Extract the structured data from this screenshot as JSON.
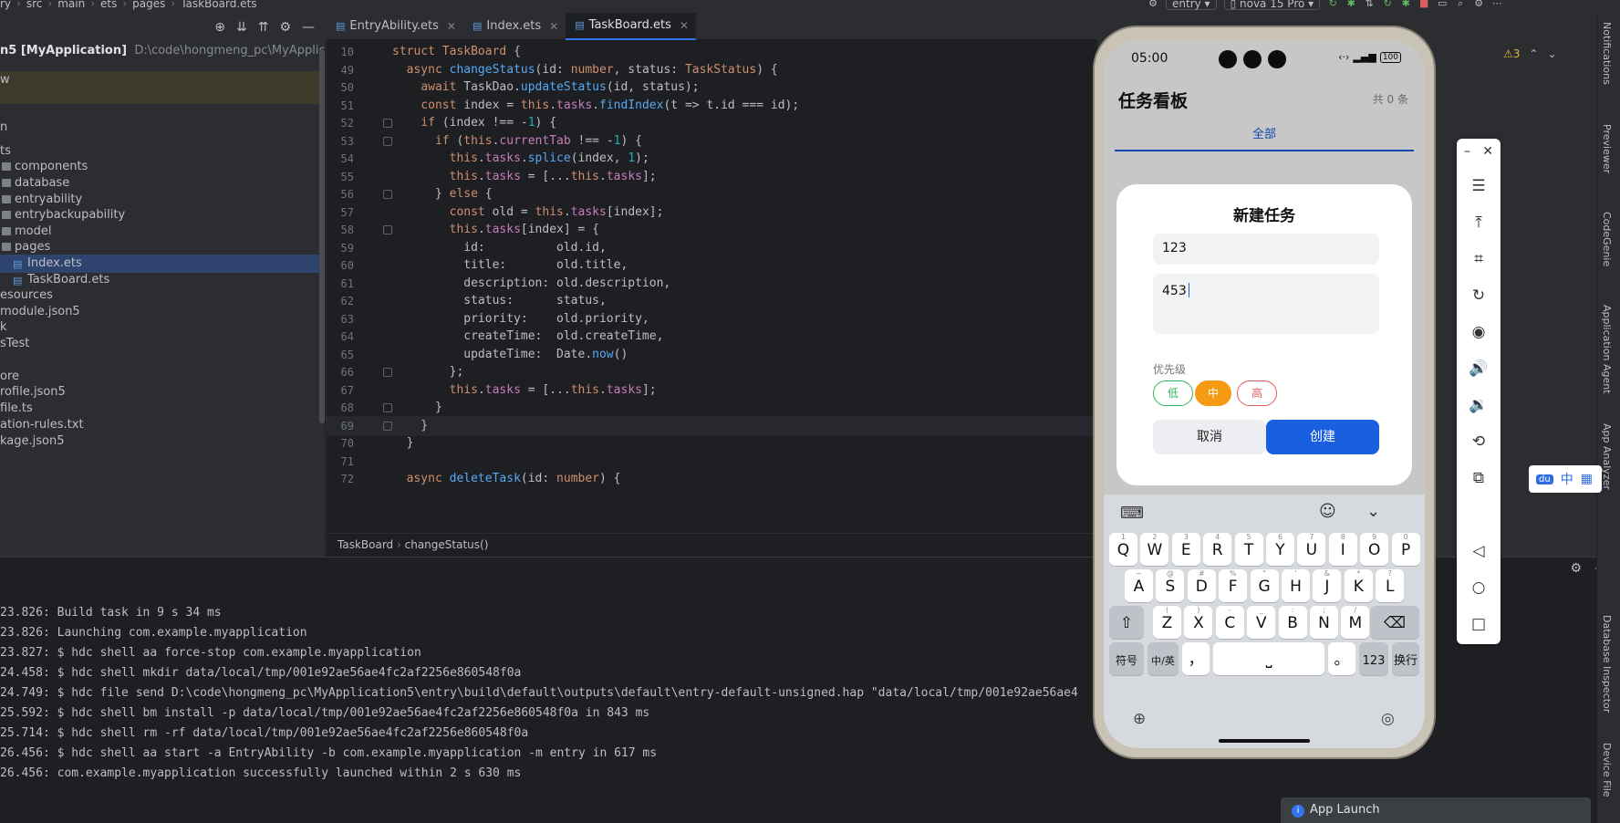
{
  "topbar": {
    "crumbs": [
      "ry",
      "src",
      "main",
      "ets",
      "pages",
      "TaskBoard.ets"
    ],
    "run_config": "entry",
    "device": "nova 15 Pro"
  },
  "project": {
    "root_name": "n5 [MyApplication]",
    "root_path": "D:\\code\\hongmeng_pc\\MyApplication5",
    "rows": [
      {
        "label": "w",
        "kind": "text",
        "indent": 0,
        "hl": true
      },
      {
        "label": "n",
        "kind": "text",
        "indent": 0
      },
      {
        "label": "ts",
        "kind": "text",
        "indent": 0
      },
      {
        "label": "components",
        "kind": "folder",
        "indent": 1
      },
      {
        "label": "database",
        "kind": "folder",
        "indent": 1
      },
      {
        "label": "entryability",
        "kind": "folder",
        "indent": 1
      },
      {
        "label": "entrybackupability",
        "kind": "folder",
        "indent": 1
      },
      {
        "label": "model",
        "kind": "folder",
        "indent": 1
      },
      {
        "label": "pages",
        "kind": "folder",
        "indent": 1
      },
      {
        "label": "Index.ets",
        "kind": "file",
        "indent": 2,
        "sel": true
      },
      {
        "label": "TaskBoard.ets",
        "kind": "file",
        "indent": 2
      },
      {
        "label": "esources",
        "kind": "text",
        "indent": 0
      },
      {
        "label": "module.json5",
        "kind": "text",
        "indent": 0
      },
      {
        "label": "k",
        "kind": "text",
        "indent": 0
      },
      {
        "label": "sTest",
        "kind": "text",
        "indent": 0
      },
      {
        "label": "",
        "kind": "text",
        "indent": 0
      },
      {
        "label": "ore",
        "kind": "text",
        "indent": 0
      },
      {
        "label": "rofile.json5",
        "kind": "text",
        "indent": 0
      },
      {
        "label": "file.ts",
        "kind": "text",
        "indent": 0
      },
      {
        "label": "ation-rules.txt",
        "kind": "text",
        "indent": 0
      },
      {
        "label": "kage.json5",
        "kind": "text",
        "indent": 0
      }
    ]
  },
  "tabs": [
    {
      "label": "EntryAbility.ets",
      "active": false
    },
    {
      "label": "Index.ets",
      "active": false
    },
    {
      "label": "TaskBoard.ets",
      "active": true
    }
  ],
  "warnings": {
    "count": "3"
  },
  "code_lines": [
    {
      "n": "10",
      "html": "<span class=\"kw\">struct</span> <span class=\"ty\">TaskBoard</span> {"
    },
    {
      "n": "49",
      "html": "  <span class=\"kw\">async</span> <span class=\"fn\">changeStatus</span>(id: <span class=\"kw\">number</span>, status: <span class=\"ty\">TaskStatus</span>) {"
    },
    {
      "n": "50",
      "html": "    <span class=\"kw\">await</span> TaskDao.<span class=\"fn\">updateStatus</span>(id, status);"
    },
    {
      "n": "51",
      "html": "    <span class=\"kw\">const</span> index = <span class=\"kw\">this</span>.<span class=\"pr\">tasks</span>.<span class=\"fn\">findIndex</span>(t => t.id === id);"
    },
    {
      "n": "52",
      "html": "    <span class=\"kw\">if</span> (index !== -<span class=\"nm\">1</span>) {"
    },
    {
      "n": "53",
      "html": "      <span class=\"kw\">if</span> (<span class=\"kw\">this</span>.<span class=\"pr\">currentTab</span> !== -<span class=\"nm\">1</span>) {"
    },
    {
      "n": "54",
      "html": "        <span class=\"kw\">this</span>.<span class=\"pr\">tasks</span>.<span class=\"fn\">splice</span>(index, <span class=\"nm\">1</span>);"
    },
    {
      "n": "55",
      "html": "        <span class=\"kw\">this</span>.<span class=\"pr\">tasks</span> = [...<span class=\"kw\">this</span>.<span class=\"pr\">tasks</span>];"
    },
    {
      "n": "56",
      "html": "      } <span class=\"kw\">else</span> {"
    },
    {
      "n": "57",
      "html": "        <span class=\"kw\">const</span> old = <span class=\"kw\">this</span>.<span class=\"pr\">tasks</span>[index];"
    },
    {
      "n": "58",
      "html": "        <span class=\"kw\">this</span>.<span class=\"pr\">tasks</span>[index] = {"
    },
    {
      "n": "59",
      "html": "          id:          old.id,"
    },
    {
      "n": "60",
      "html": "          title:       old.title,"
    },
    {
      "n": "61",
      "html": "          description: old.description,"
    },
    {
      "n": "62",
      "html": "          status:      status,"
    },
    {
      "n": "63",
      "html": "          priority:    old.priority,"
    },
    {
      "n": "64",
      "html": "          createTime:  old.createTime,"
    },
    {
      "n": "65",
      "html": "          updateTime:  Date.<span class=\"fn\">now</span>()"
    },
    {
      "n": "66",
      "html": "        };"
    },
    {
      "n": "67",
      "html": "        <span class=\"kw\">this</span>.<span class=\"pr\">tasks</span> = [...<span class=\"kw\">this</span>.<span class=\"pr\">tasks</span>];"
    },
    {
      "n": "68",
      "html": "      }"
    },
    {
      "n": "69",
      "html": "    }"
    },
    {
      "n": "70",
      "html": "  }"
    },
    {
      "n": "71",
      "html": ""
    },
    {
      "n": "72",
      "html": "  <span class=\"kw\">async</span> <span class=\"fn\">deleteTask</span>(id: <span class=\"kw\">number</span>) {"
    }
  ],
  "breadcrumb": {
    "a": "TaskBoard",
    "b": "changeStatus()"
  },
  "log_lines": [
    "23.826: Build task in 9 s 34 ms",
    "23.826: Launching com.example.myapplication",
    "23.827: $ hdc shell aa force-stop com.example.myapplication",
    "24.458: $ hdc shell mkdir data/local/tmp/001e92ae56ae4fc2af2256e860548f0a",
    "24.749: $ hdc file send D:\\code\\hongmeng_pc\\MyApplication5\\entry\\build\\default\\outputs\\default\\entry-default-unsigned.hap \"data/local/tmp/001e92ae56ae4",
    "25.592: $ hdc shell bm install -p data/local/tmp/001e92ae56ae4fc2af2256e860548f0a in 843 ms",
    "25.714: $ hdc shell rm -rf data/local/tmp/001e92ae56ae4fc2af2256e860548f0a",
    "26.456: $ hdc shell aa start -a EntryAbility -b com.example.myapplication -m entry in 617 ms",
    "26.456: com.example.myapplication successfully launched within 2 s 630 ms"
  ],
  "app_launch": "App Launch",
  "right_strip": [
    "Notifications",
    "Previewer",
    "CodeGenie",
    "Application Agent",
    "App Analyzer",
    "Database Inspector",
    "Device File"
  ],
  "phone": {
    "time": "05:00",
    "battery": "100",
    "app_title": "任务看板",
    "count": "共 0 条",
    "tab_all": "全部",
    "dialog": {
      "title": "新建任务",
      "title_value": "123",
      "desc_value": "453",
      "prio_label": "优先级",
      "prio_low": "低",
      "prio_mid": "中",
      "prio_high": "高",
      "cancel": "取消",
      "create": "创建"
    },
    "keyboard": {
      "row1": [
        [
          "Q",
          "1"
        ],
        [
          "W",
          "2"
        ],
        [
          "E",
          "3"
        ],
        [
          "R",
          "4"
        ],
        [
          "T",
          "5"
        ],
        [
          "Y",
          "6"
        ],
        [
          "U",
          "7"
        ],
        [
          "I",
          "8"
        ],
        [
          "O",
          "9"
        ],
        [
          "P",
          "0"
        ]
      ],
      "row2": [
        [
          "A",
          "~"
        ],
        [
          "S",
          "@"
        ],
        [
          "D",
          "#"
        ],
        [
          "F",
          "%"
        ],
        [
          "G",
          "\""
        ],
        [
          "H",
          "'"
        ],
        [
          "J",
          "&"
        ],
        [
          "K",
          "*"
        ],
        [
          "L",
          "?"
        ]
      ],
      "row3": [
        [
          "Z",
          "("
        ],
        [
          "X",
          ")"
        ],
        [
          "C",
          "-"
        ],
        [
          "V",
          "_"
        ],
        [
          "B",
          ":"
        ],
        [
          "N",
          ";"
        ],
        [
          "M",
          "/"
        ]
      ],
      "symbols": "符号",
      "lang": "中/英",
      "comma": "，",
      "period": "。",
      "num": "123",
      "enter": "换行"
    }
  },
  "ime_bar": {
    "lang": "中"
  }
}
